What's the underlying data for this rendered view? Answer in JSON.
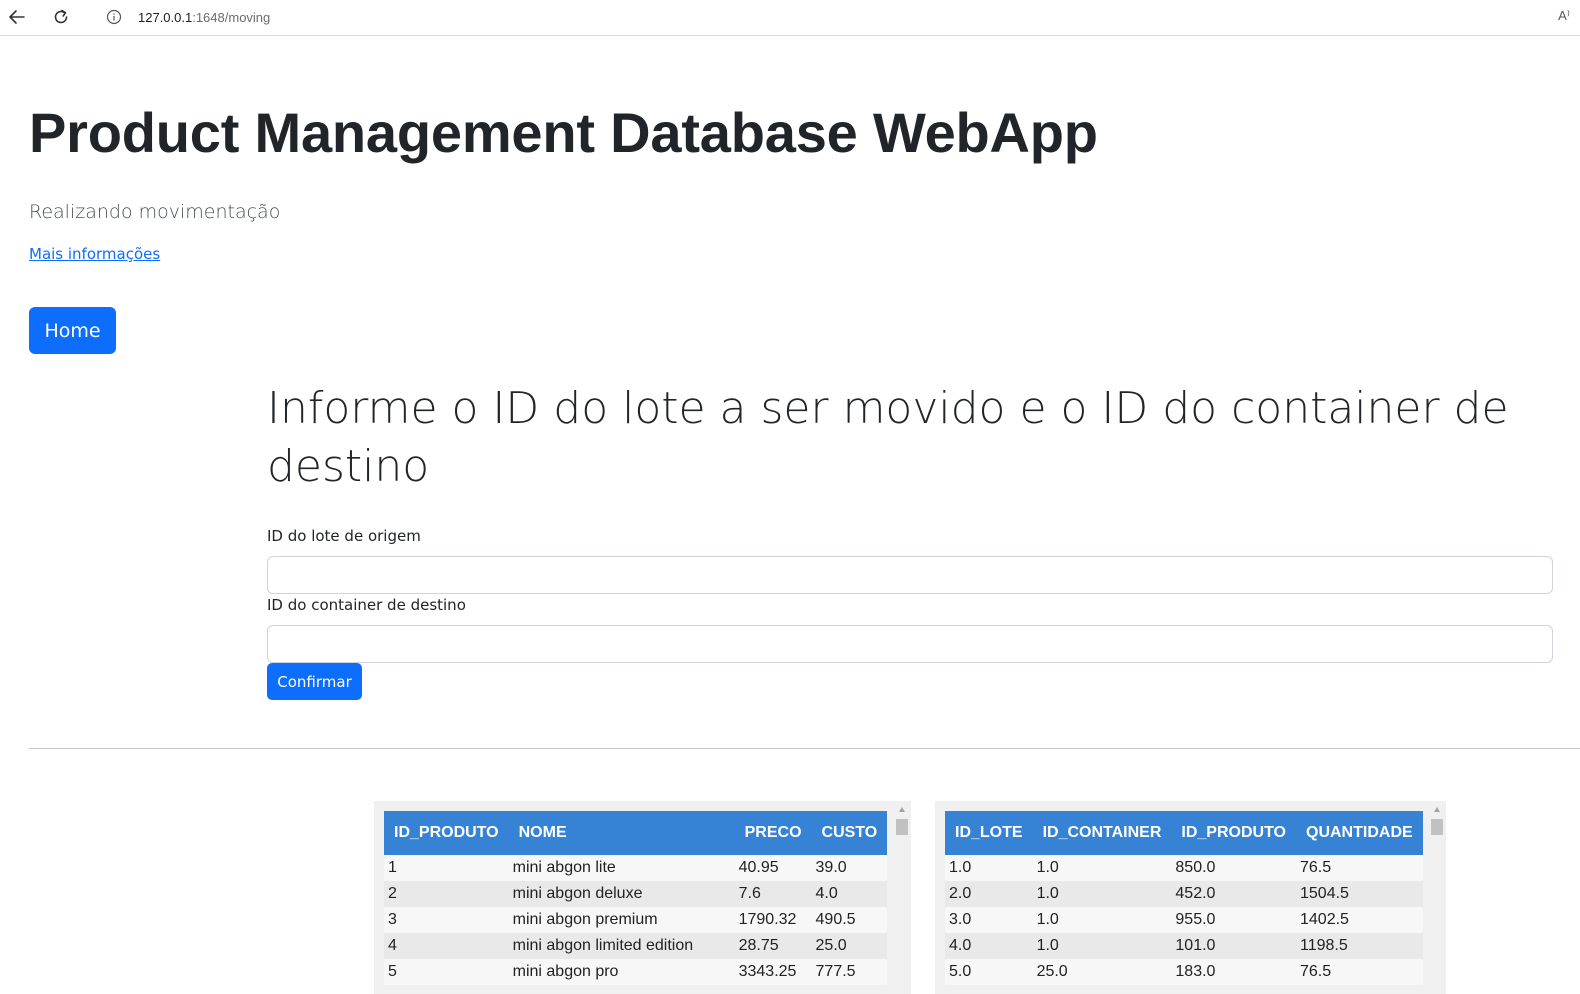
{
  "browser": {
    "url_host": "127.0.0.1",
    "url_path": ":1648/moving",
    "read_aloud_label": "A⁾"
  },
  "header": {
    "title": "Product Management Database WebApp",
    "subtitle": "Realizando movimentação",
    "more_link": "Mais informações",
    "home_button": "Home"
  },
  "form": {
    "heading": "Informe o ID do lote a ser movido e o ID do container de destino",
    "origin_label": "ID do lote de origem",
    "origin_value": "",
    "dest_label": "ID do container de destino",
    "dest_value": "",
    "confirm_button": "Confirmar"
  },
  "products_table": {
    "columns": [
      "ID_PRODUTO",
      "NOME",
      "PRECO",
      "CUSTO"
    ],
    "rows": [
      [
        "1",
        "mini abgon lite",
        "40.95",
        "39.0"
      ],
      [
        "2",
        "mini abgon deluxe",
        "7.6",
        "4.0"
      ],
      [
        "3",
        "mini abgon premium",
        "1790.32",
        "490.5"
      ],
      [
        "4",
        "mini abgon limited edition",
        "28.75",
        "25.0"
      ],
      [
        "5",
        "mini abgon pro",
        "3343.25",
        "777.5"
      ]
    ]
  },
  "lotes_table": {
    "columns": [
      "ID_LOTE",
      "ID_CONTAINER",
      "ID_PRODUTO",
      "QUANTIDADE"
    ],
    "rows": [
      [
        "1.0",
        "1.0",
        "850.0",
        "76.5"
      ],
      [
        "2.0",
        "1.0",
        "452.0",
        "1504.5"
      ],
      [
        "3.0",
        "1.0",
        "955.0",
        "1402.5"
      ],
      [
        "4.0",
        "1.0",
        "101.0",
        "1198.5"
      ],
      [
        "5.0",
        "25.0",
        "183.0",
        "76.5"
      ]
    ]
  },
  "colors": {
    "primary": "#0d6efd",
    "table_header": "#3682d4"
  }
}
